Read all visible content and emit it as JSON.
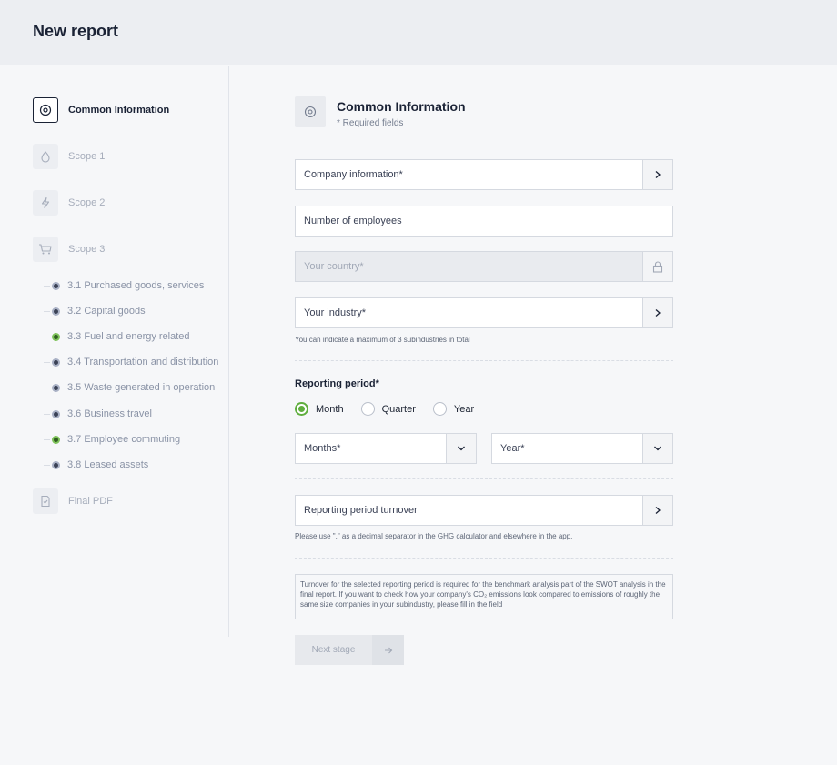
{
  "page": {
    "title": "New report"
  },
  "sidebar": {
    "steps": [
      {
        "label": "Common Information",
        "icon": "location-pin-icon",
        "active": true
      },
      {
        "label": "Scope 1",
        "icon": "drop-icon"
      },
      {
        "label": "Scope 2",
        "icon": "lightning-icon"
      },
      {
        "label": "Scope 3",
        "icon": "cart-icon"
      },
      {
        "label": "Final PDF",
        "icon": "document-icon"
      }
    ],
    "substeps": [
      {
        "label": "3.1 Purchased goods, services",
        "status": "default"
      },
      {
        "label": "3.2 Capital goods",
        "status": "default"
      },
      {
        "label": "3.3 Fuel and energy related",
        "status": "green"
      },
      {
        "label": "3.4 Transportation and distribution",
        "status": "default"
      },
      {
        "label": "3.5 Waste generated in operation",
        "status": "default"
      },
      {
        "label": "3.6 Business travel",
        "status": "default"
      },
      {
        "label": "3.7 Employee commuting",
        "status": "green"
      },
      {
        "label": "3.8 Leased assets",
        "status": "default"
      }
    ]
  },
  "form": {
    "title": "Common Information",
    "subtitle": "* Required fields",
    "company_info": "Company information*",
    "employees": "Number of employees",
    "country": "Your country*",
    "industry": "Your industry*",
    "industry_hint": "You can indicate a maximum of 3 subindustries in total",
    "reporting_period_label": "Reporting period*",
    "period_options": [
      "Month",
      "Quarter",
      "Year"
    ],
    "period_selected": "Month",
    "months_placeholder": "Months*",
    "year_placeholder": "Year*",
    "turnover": "Reporting period turnover",
    "turnover_hint": "Please use \".\" as a decimal separator in the GHG calculator and elsewhere in the app.",
    "note": "Turnover for the selected reporting period is required for the benchmark analysis part of the SWOT analysis in the final report. If you want to check how your company's CO₂ emissions look compared to emissions of roughly the same size companies in your subindustry, please fill in the field",
    "next_label": "Next stage"
  },
  "colors": {
    "accent_green": "#5fae3e",
    "text_dark": "#1a2235",
    "muted": "#a6adbb"
  }
}
